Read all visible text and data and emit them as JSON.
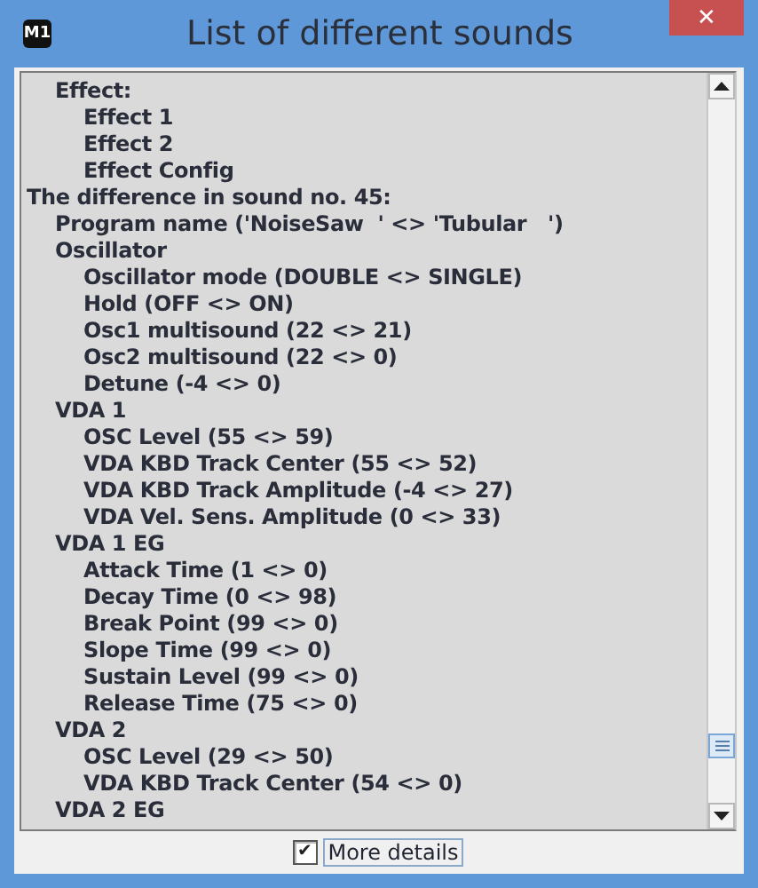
{
  "window": {
    "title": "List of different sounds",
    "icon_text": "M1",
    "close": "✕"
  },
  "tree": [
    {
      "children": [
        {
          "text": "Effect:",
          "children": [
            {
              "text": "Effect 1"
            },
            {
              "text": "Effect 2"
            },
            {
              "text": "Effect Config"
            }
          ]
        }
      ]
    },
    {
      "text": "The difference in sound no. 45:",
      "children": [
        {
          "text": "Program name ('NoiseSaw  ' <> 'Tubular   ')"
        },
        {
          "text": "Oscillator",
          "children": [
            {
              "text": "Oscillator mode (DOUBLE <> SINGLE)"
            },
            {
              "text": "Hold (OFF <> ON)"
            },
            {
              "text": "Osc1 multisound (22 <> 21)"
            },
            {
              "text": "Osc2 multisound (22 <> 0)"
            },
            {
              "text": "Detune (-4 <> 0)"
            }
          ]
        },
        {
          "text": "VDA 1",
          "children": [
            {
              "text": "OSC Level (55 <> 59)"
            },
            {
              "text": "VDA KBD Track Center (55 <> 52)"
            },
            {
              "text": "VDA KBD Track Amplitude (-4 <> 27)"
            },
            {
              "text": "VDA Vel. Sens. Amplitude (0 <> 33)"
            }
          ]
        },
        {
          "text": "VDA 1 EG",
          "children": [
            {
              "text": "Attack Time (1 <> 0)"
            },
            {
              "text": "Decay Time (0 <> 98)"
            },
            {
              "text": "Break Point (99 <> 0)"
            },
            {
              "text": "Slope Time (99 <> 0)"
            },
            {
              "text": "Sustain Level (99 <> 0)"
            },
            {
              "text": "Release Time (75 <> 0)"
            }
          ]
        },
        {
          "text": "VDA 2",
          "children": [
            {
              "text": "OSC Level (29 <> 50)"
            },
            {
              "text": "VDA KBD Track Center (54 <> 0)"
            }
          ]
        },
        {
          "text": "VDA 2 EG"
        }
      ]
    }
  ],
  "more_details": {
    "label": "More details",
    "checked": true,
    "mark": "✔"
  }
}
